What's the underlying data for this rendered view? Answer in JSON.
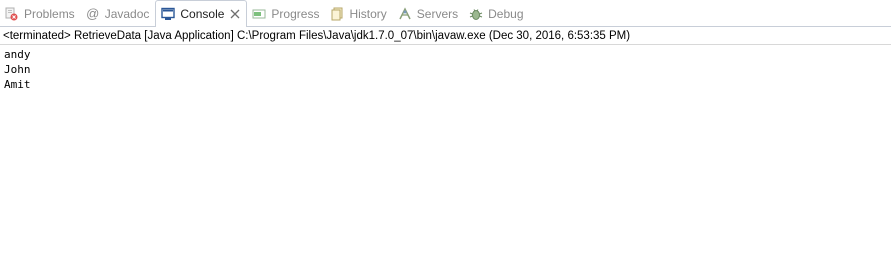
{
  "tabs": [
    {
      "label": "Problems",
      "icon": "problems-icon",
      "active": false
    },
    {
      "label": "Javadoc",
      "icon": "javadoc-at-icon",
      "active": false
    },
    {
      "label": "Console",
      "icon": "console-icon",
      "active": true
    },
    {
      "label": "Progress",
      "icon": "progress-icon",
      "active": false
    },
    {
      "label": "History",
      "icon": "history-icon",
      "active": false
    },
    {
      "label": "Servers",
      "icon": "servers-icon",
      "active": false
    },
    {
      "label": "Debug",
      "icon": "debug-icon",
      "active": false
    }
  ],
  "console": {
    "header": "<terminated> RetrieveData [Java Application] C:\\Program Files\\Java\\jdk1.7.0_07\\bin\\javaw.exe (Dec 30, 2016, 6:53:35 PM)",
    "output_lines": [
      "andy",
      "John",
      "Amit"
    ]
  }
}
